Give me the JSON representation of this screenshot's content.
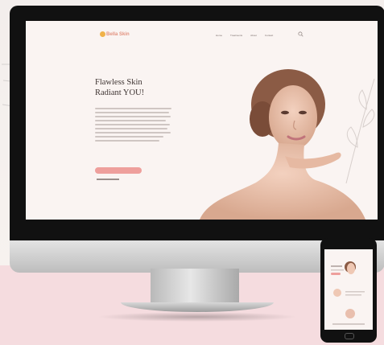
{
  "website": {
    "brand": "Bella Skin",
    "nav_items": [
      "Home",
      "Treatments",
      "About",
      "Contact"
    ],
    "hero_title_line1": "Flawless Skin",
    "hero_title_line2": "Radiant YOU!"
  },
  "colors": {
    "accent": "#ee9f9c",
    "logo": "#e2927f",
    "page_bg": "#faf4f2"
  },
  "icons": [
    "search-icon"
  ]
}
